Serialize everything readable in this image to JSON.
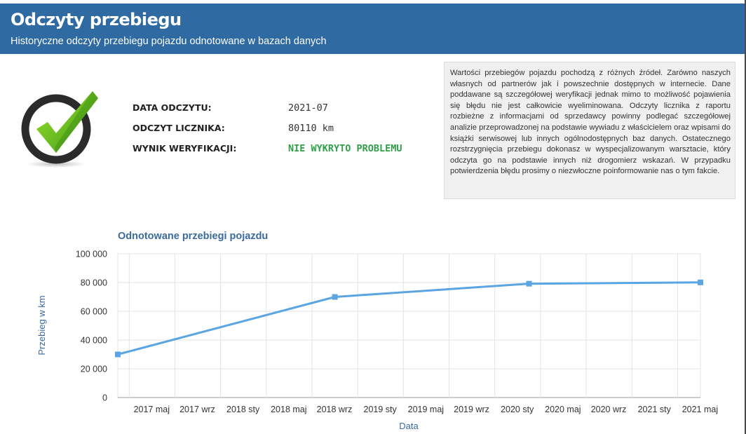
{
  "header": {
    "title": "Odczyty przebiegu",
    "subtitle": "Historyczne odczyty przebiegu pojazdu odnotowane w bazach danych"
  },
  "status_icon": "checkmark-success-icon",
  "reading": {
    "date_label": "DATA ODCZYTU:",
    "date_value": "2021-07",
    "odometer_label": "ODCZYT LICZNIKA:",
    "odometer_value": "80110 km",
    "result_label": "WYNIK WERYFIKACJI:",
    "result_value": "NIE WYKRYTO PROBLEMU"
  },
  "note_text": "Wartości przebiegów pojazdu pochodzą z różnych źródeł. Zarówno naszych własnych od partnerów jak i powszechnie dostępnych w internecie. Dane poddawane są szczegółowej weryfikacji jednak mimo to możliwość pojawienia się błędu nie jest całkowicie wyeliminowana. Odczyty licznika z raportu rozbieżne z informacjami od sprzedawcy powinny podlegać szczegółowej analizie przeprowadzonej na podstawie wywiadu z właścicielem oraz wpisami do książki serwisowej lub innych ogólnodostępnych baz danych. Ostatecznego rozstrzygnięcia przebiegu dokonasz w wyspecjalizowanym warsztacie, który odczyta go na podstawie innych niż drogomierz wskazań. W przypadku potwierdzenia błędu prosimy o niezwłoczne poinformowanie nas o tym fakcie.",
  "colors": {
    "header_bg": "#2f6aa3",
    "ok_text": "#2e9e48",
    "series_line": "#5aa5e2",
    "chart_title": "#3a6a9e"
  },
  "chart_data": {
    "type": "line",
    "title": "Odnotowane przebiegi pojazdu",
    "xlabel": "Data",
    "ylabel": "Przebieg w km",
    "x_ticks": [
      "2017 maj",
      "2017 wrz",
      "2018 sty",
      "2018 maj",
      "2018 wrz",
      "2019 sty",
      "2019 maj",
      "2019 wrz",
      "2020 sty",
      "2020 maj",
      "2020 wrz",
      "2021 sty",
      "2021 maj"
    ],
    "y_ticks": [
      "0",
      "20 000",
      "40 000",
      "60 000",
      "80 000",
      "100 000"
    ],
    "ylim": [
      0,
      100000
    ],
    "grid": true,
    "series": [
      {
        "points": [
          {
            "x": "2017-04",
            "y": 30000
          },
          {
            "x": "2018-11",
            "y": 70000
          },
          {
            "x": "2020-04",
            "y": 79200
          },
          {
            "x": "2021-07",
            "y": 80110
          }
        ]
      }
    ]
  }
}
